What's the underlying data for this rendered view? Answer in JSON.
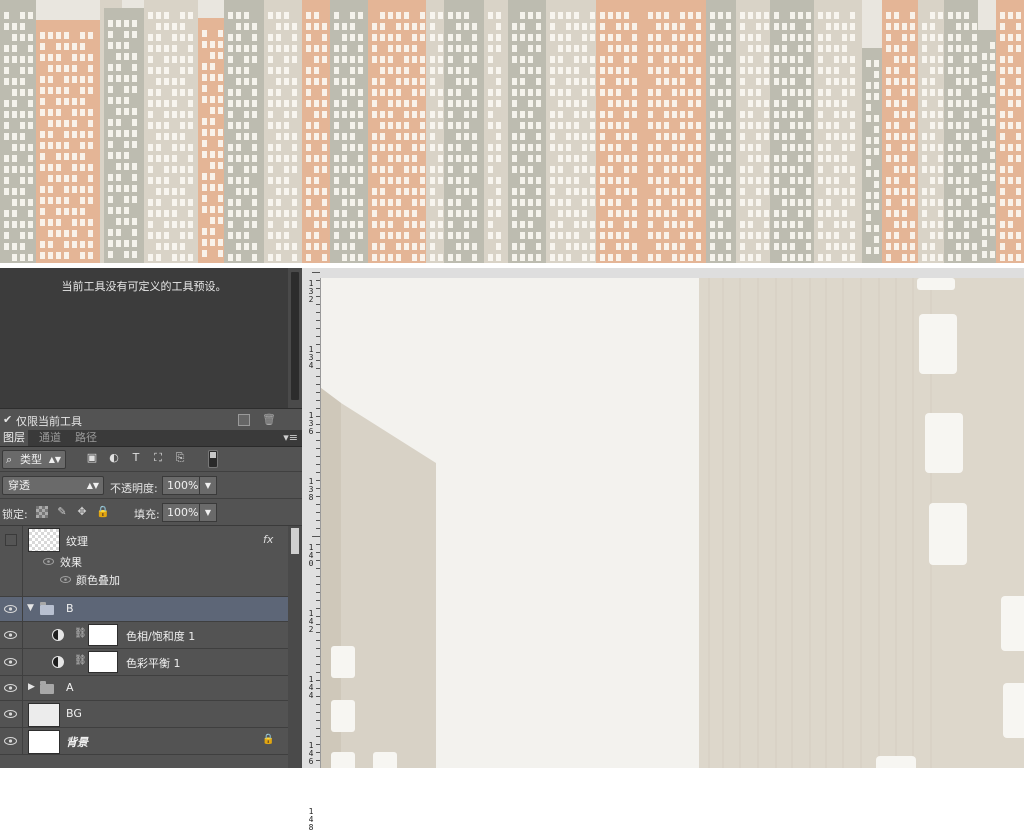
{
  "options_panel": {
    "preset_message": "当前工具没有可定义的工具预设。",
    "current_tool_check": "✔",
    "current_tool_label": "仅限当前工具"
  },
  "layers_panel": {
    "tabs": [
      "图层",
      "通道",
      "路径"
    ],
    "panel_menu": "▾≡",
    "filter": {
      "label": "类型"
    },
    "blend_mode": "穿透",
    "opacity_label": "不透明度:",
    "opacity_value": "100%",
    "lock_label": "锁定:",
    "fill_label": "填充:",
    "fill_value": "100%",
    "layers": [
      {
        "name": "纹理",
        "fx": "fx",
        "visible": false,
        "effects_label": "效果",
        "effect": "颜色叠加"
      },
      {
        "name": "B",
        "type": "group",
        "expanded": true,
        "selected": true
      },
      {
        "name": "色相/饱和度 1",
        "type": "adjustment"
      },
      {
        "name": "色彩平衡 1",
        "type": "adjustment"
      },
      {
        "name": "A",
        "type": "group",
        "expanded": false
      },
      {
        "name": "BG",
        "type": "layer"
      },
      {
        "name": "背景",
        "type": "background",
        "locked": true
      }
    ]
  },
  "ruler": {
    "labels": [
      "1\n3\n2",
      "1\n3\n4",
      "1\n3\n6",
      "1\n3\n8",
      "1\n4\n0",
      "1\n4\n2",
      "1\n4\n4",
      "1\n4\n6",
      "1\n4\n8"
    ]
  },
  "colors": {
    "panel_bg": "#535353",
    "selected_row": "#5d6677",
    "canvas_bg": "#f3f2ee",
    "building_beige": "#d9d3c7",
    "building_orange": "#e4b596",
    "building_grey": "#bdbcb0"
  }
}
